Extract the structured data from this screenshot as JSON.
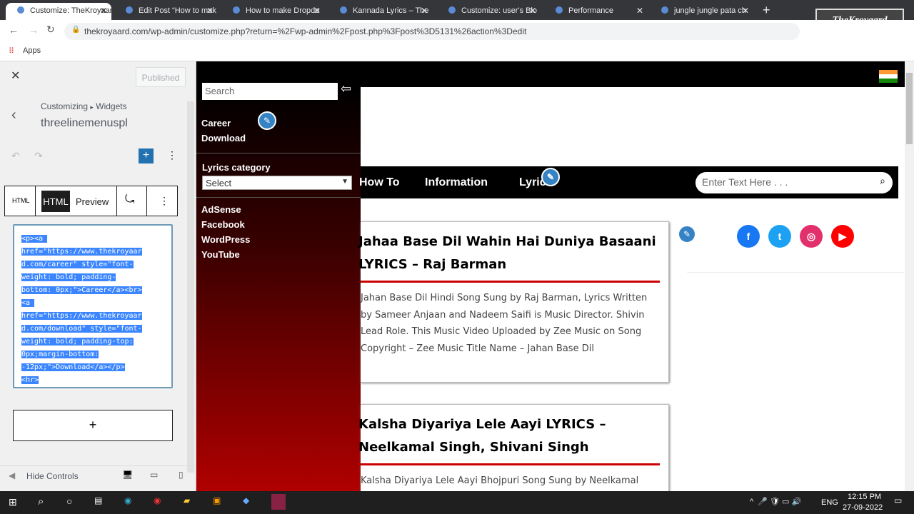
{
  "browser": {
    "tabs": [
      {
        "title": "Customize: TheKroyaard",
        "active": true
      },
      {
        "title": "Edit Post “How to mak"
      },
      {
        "title": "How to make Dropdo"
      },
      {
        "title": "Kannada Lyrics – The"
      },
      {
        "title": "Customize: user's Blo"
      },
      {
        "title": "Performance"
      },
      {
        "title": "jungle jungle pata ch"
      }
    ],
    "url": "thekroyaard.com/wp-admin/customize.php?return=%2Fwp-admin%2Fpost.php%3Fpost%3D5131%26action%3Dedit",
    "bookmark": "Apps",
    "watermark": "TheKroyaard"
  },
  "customizer": {
    "published": "Published",
    "breadcrumb": "Customizing",
    "breadcrumb_sep": "▸",
    "section": "Widgets",
    "title": "threelinemenuspl",
    "tabs": {
      "html_small": "HTML",
      "html": "HTML",
      "preview": "Preview"
    },
    "code_lines": [
      "<p><a ",
      "href=\"https://www.thekroyaar",
      "d.com/career\" style=\"font-",
      "weight: bold; padding-",
      "bottom: 0px;\">Career</a><br>",
      "<a ",
      "href=\"https://www.thekroyaar",
      "d.com/download\" style=\"font-",
      "weight: bold; padding-top:",
      "0px;margin-bottom:",
      "-12px;\">Download</a></p>",
      "<hr>"
    ],
    "add": "+",
    "hide_controls": "Hide Controls"
  },
  "preview": {
    "search_placeholder": "Search",
    "links": [
      "Career",
      "Download"
    ],
    "lyrics_category": "Lyrics category",
    "select": "Select",
    "side_links": [
      "AdSense",
      "Facebook",
      "WordPress",
      "YouTube"
    ],
    "nav": [
      "How To",
      "Information",
      "Lyrics"
    ],
    "nav_search_placeholder": "Enter Text Here . . .",
    "posts": [
      {
        "title": "Jahaa Base Dil Wahin Hai Duniya Basaani LYRICS – Raj Barman",
        "excerpt": "Jahan Base Dil Hindi Song Sung by Raj Barman, Lyrics Written by Sameer Anjaan and Nadeem Saifi is Music Director. Shivin Lead Role. This Music Video Uploaded by Zee Music on Song Copyright – Zee Music Title Name – Jahan Base Dil"
      },
      {
        "title": "Kalsha Diyariya Lele Aayi LYRICS – Neelkamal Singh, Shivani Singh",
        "excerpt": "Kalsha Diyariya Lele Aayi Bhojpuri Song Sung by Neelkamal"
      }
    ],
    "social": [
      {
        "name": "facebook",
        "color": "#1877f2",
        "glyph": "f"
      },
      {
        "name": "twitter",
        "color": "#1da1f2",
        "glyph": "t"
      },
      {
        "name": "instagram",
        "color": "#e1306c",
        "glyph": "◎"
      },
      {
        "name": "youtube",
        "color": "#ff0000",
        "glyph": "▶"
      }
    ]
  },
  "taskbar": {
    "lang": "ENG",
    "time": "12:15 PM",
    "date": "27-09-2022"
  }
}
